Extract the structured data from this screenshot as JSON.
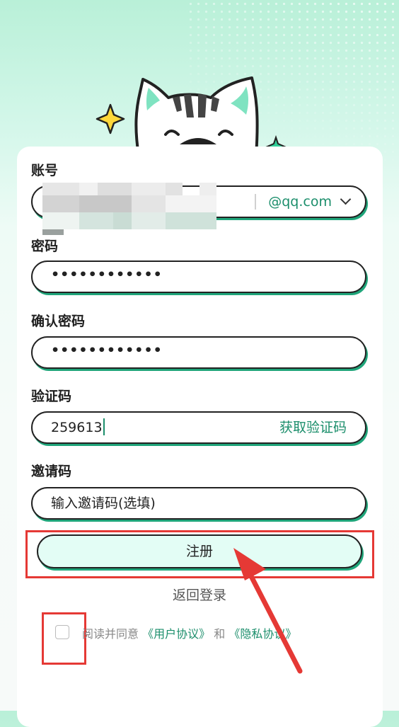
{
  "form": {
    "account": {
      "label": "账号",
      "domain": "@qq.com"
    },
    "password": {
      "label": "密码",
      "masked_value": "••••••••••••"
    },
    "confirm": {
      "label": "确认密码",
      "masked_value": "••••••••••••"
    },
    "code": {
      "label": "验证码",
      "value": "259613",
      "get_code_label": "获取验证码"
    },
    "invite": {
      "label": "邀请码",
      "placeholder": "输入邀请码(选填)"
    }
  },
  "buttons": {
    "register": "注册",
    "back_login": "返回登录"
  },
  "agreement": {
    "prefix": "阅读并同意",
    "user_agreement": "《用户协议》",
    "and": "和",
    "privacy_policy": "《隐私协议》"
  },
  "colors": {
    "accent": "#1b8e6b",
    "highlight": "#e53935"
  }
}
